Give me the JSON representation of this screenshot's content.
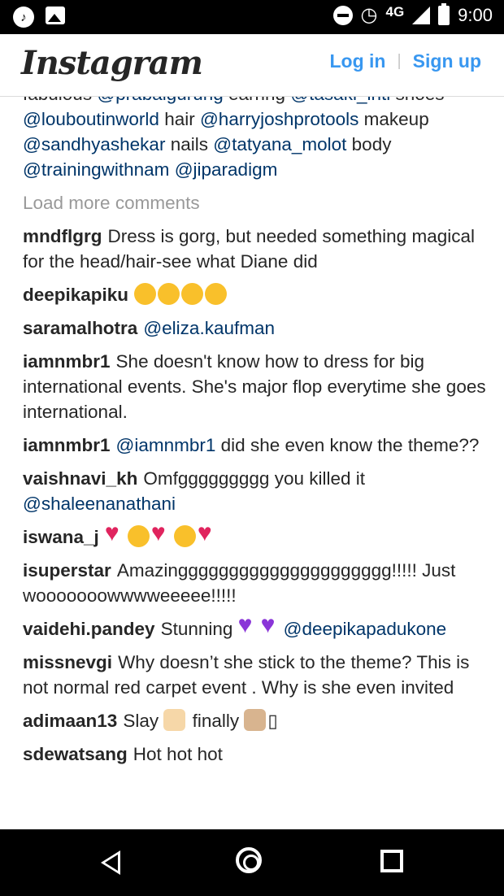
{
  "status_bar": {
    "time": "9:00",
    "network": "4G",
    "icons": [
      "music-app-icon",
      "gallery-icon",
      "do-not-disturb-icon",
      "alarm-icon",
      "signal-icon",
      "battery-icon"
    ]
  },
  "header": {
    "logo": "Instagram",
    "login_label": "Log in",
    "separator": "|",
    "signup_label": "Sign up",
    "accent_color": "#3897f0"
  },
  "caption_tail": {
    "line1_a": "fabulous ",
    "line1_m1": "@prabalgurung",
    "line1_b": " earring ",
    "line1_m2": "@tasaki_intl",
    "line1_c": " shoes",
    "line2_m1": "@louboutinworld",
    "line2_b": " hair ",
    "line2_m2": "@harryjoshprotools",
    "line2_c": " makeup",
    "line3_m1": "@sandhyashekar",
    "line3_b": " nails ",
    "line3_m2": "@tatyana_molot",
    "line3_c": " body",
    "line4_m1": "@trainingwithnam",
    "line4_b": " ",
    "line4_m2": "@jiparadigm"
  },
  "load_more": "Load more comments",
  "comments": [
    {
      "user": "mndflgrg",
      "text": "Dress is gorg, but needed something magical for the head/hair-see what Diane did"
    },
    {
      "user": "deepikapiku",
      "text": ""
    },
    {
      "user": "saramalhotra",
      "mention": "@eliza.kaufman"
    },
    {
      "user": "iamnmbr1",
      "text": "She doesn't know how to dress for big international events. She's major flop everytime she goes international."
    },
    {
      "user": "iamnmbr1",
      "mention": "@iamnmbr1",
      "text": " did she even know the theme??"
    },
    {
      "user": "vaishnavi_kh",
      "text": "Omfggggggggg you killed it",
      "mention": "@shaleenanathani"
    },
    {
      "user": "iswana_j",
      "text": ""
    },
    {
      "user": "isuperstar",
      "text": "Amazinggggggggggggggggggggg!!!!! Just wooooooowwwweeeee!!!!!"
    },
    {
      "user": "vaidehi.pandey",
      "text": "Stunning ",
      "mention": "@deepikapadukone"
    },
    {
      "user": "missnevgi",
      "text": "Why doesn’t she stick to the theme? This is not normal red carpet event . Why is she even invited"
    },
    {
      "user": "adimaan13",
      "text_a": "Slay ",
      "text_b": " finally ",
      "text_c": "▯"
    },
    {
      "user": "sdewatsang",
      "text": "Hot hot hot"
    }
  ],
  "colors": {
    "mention": "#003569",
    "text": "#262626",
    "muted": "#999999"
  }
}
